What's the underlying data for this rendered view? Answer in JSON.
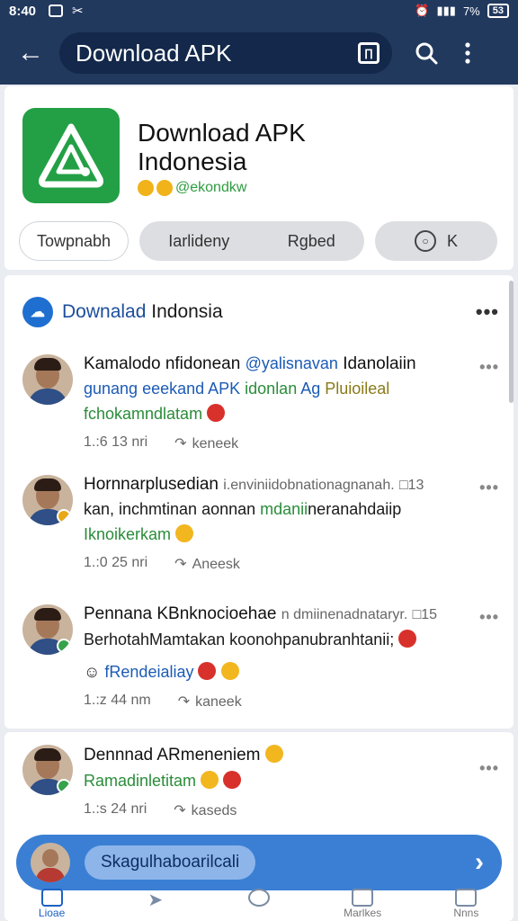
{
  "status_bar": {
    "time": "8:40",
    "signal_text": "7%",
    "battery": "53"
  },
  "appbar": {
    "title": "Download APK",
    "box_icon_label": "∏"
  },
  "app": {
    "title_line1": "Download APK",
    "title_line2": "Indonesia",
    "developer": "@ekondkw",
    "chips": {
      "c1": "Towpnabh",
      "c2a": "Iarlideny",
      "c2b": "Rgbed",
      "c3": "K"
    }
  },
  "group": {
    "name_part1": "Downalad",
    "name_part2": "Indonsia"
  },
  "posts": [
    {
      "name": "Kamalodo nfidonean",
      "handle": "@yalisnavan",
      "tail": "Idanolaiin",
      "line1_a": "gunang eeekand APK ",
      "line1_b": "idonlan",
      "line1_c": " Ag",
      "line1_d": "Pluioileal",
      "line2": "fchokamndlatam",
      "time": "1.:6  13 nri",
      "share": "keneek"
    },
    {
      "name": "Hornnarplusedian",
      "tail": "i.enviniidobnationagnanah.",
      "count": "□13",
      "line1_a": "kan, inchmtinan aonnan ",
      "line1_b": "mdanii",
      "line1_c": "neranahdaiip",
      "line2": "Iknoikerkam",
      "time": "1.:0  25 nri",
      "share": "Aneesk"
    },
    {
      "name": "Pennana KBnknocioehae",
      "tail": "n dmiinenadnataryr.",
      "count": "□15",
      "line1_a": "BerhotahMamtakan koonohpanubranhtanii;",
      "line2": "fRendeialiay",
      "time": "1.:z  44 nm",
      "share": "kaneek"
    },
    {
      "name": "Dennnad ARmeneniem",
      "line1_a": "Ramadinletitam",
      "time": "1.:s  24 nri",
      "share": "kaseds"
    }
  ],
  "banner": {
    "label": "Skagulhaboarilcali"
  },
  "nav": [
    {
      "label": "Lioae"
    },
    {
      "label": ""
    },
    {
      "label": ""
    },
    {
      "label": "Marlkes"
    },
    {
      "label": "Nnns"
    }
  ]
}
